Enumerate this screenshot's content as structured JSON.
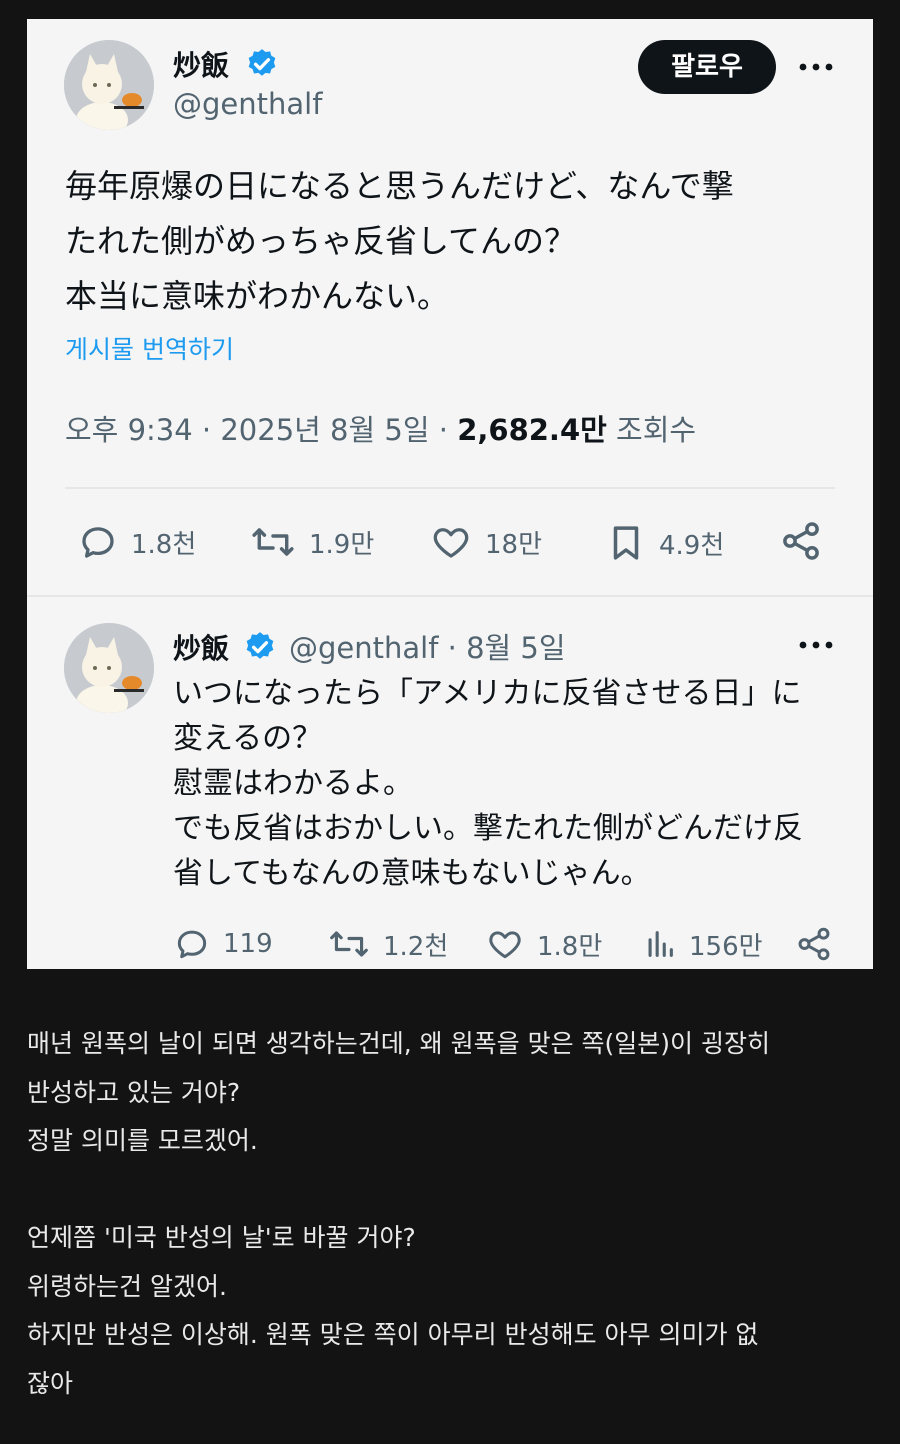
{
  "tweet": {
    "author_name": "炒飯",
    "author_handle": "@genthalf",
    "follow_label": "팔로우",
    "text": "毎年原爆の日になると思うんだけど、なんで撃\nたれた側がめっちゃ反省してんの？\n本当に意味がわかんない。",
    "translate_label": "게시물 번역하기",
    "time": "오후 9:34",
    "date": "2025년 8월 5일",
    "views_count": "2,682.4만",
    "views_label": "조회수",
    "stats": {
      "replies": "1.8천",
      "retweets": "1.9만",
      "likes": "18만",
      "bookmarks": "4.9천"
    }
  },
  "reply": {
    "author_name": "炒飯",
    "author_handle": "@genthalf",
    "date": "8월 5일",
    "text": "いつになったら「アメリカに反省させる日」に\n変えるの？\n慰霊はわかるよ。\nでも反省はおかしい。撃たれた側がどんだけ反\n省してもなんの意味もないじゃん。",
    "stats": {
      "replies": "119",
      "retweets": "1.2천",
      "likes": "1.8만",
      "views": "156만"
    }
  },
  "translation": "매년 원폭의 날이 되면 생각하는건데, 왜 원폭을 맞은 쪽(일본)이 굉장히\n반성하고 있는 거야?\n정말 의미를 모르겠어.\n\n언제쯤 '미국 반성의 날'로 바꿀 거야?\n위령하는건 알겠어.\n하지만 반성은 이상해. 원폭 맞은 쪽이 아무리 반성해도 아무 의미가 없\n잖아",
  "icons": {
    "verified": "verified-badge-icon",
    "more": "more-dots-icon",
    "reply": "reply-icon",
    "retweet": "retweet-icon",
    "like": "heart-icon",
    "bookmark": "bookmark-icon",
    "share": "share-icon",
    "views": "views-bar-icon"
  },
  "colors": {
    "background": "#131313",
    "card": "#f5f5f5",
    "accent": "#1d9bf0",
    "text": "#0f1419",
    "muted": "#536471"
  }
}
